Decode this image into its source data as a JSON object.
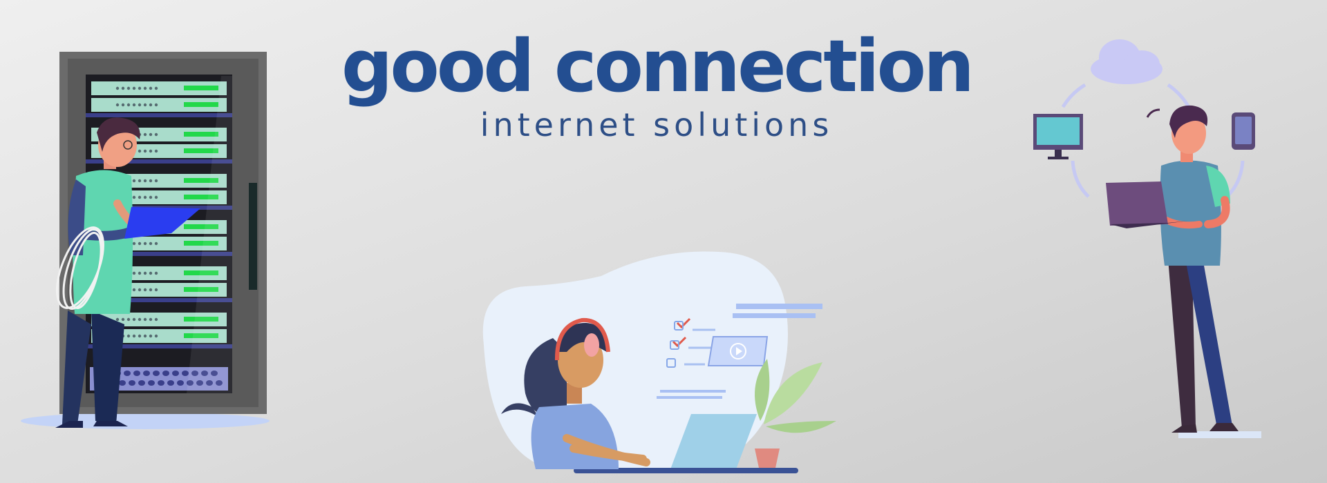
{
  "brand": {
    "title": "good connection",
    "subtitle": "internet solutions"
  },
  "palette": {
    "brand_blue": "#234e91",
    "rack_frame": "#6b6b6b",
    "server_panel": "#a9dccb",
    "server_led": "#22d84a",
    "shirt_mint": "#5fd6b0",
    "blob_light": "#e9f1fb",
    "cloud": "#c9c9f5"
  },
  "illustrations": {
    "left": "server-technician-illustration",
    "center": "remote-worker-illustration",
    "right": "connected-devices-illustration"
  }
}
